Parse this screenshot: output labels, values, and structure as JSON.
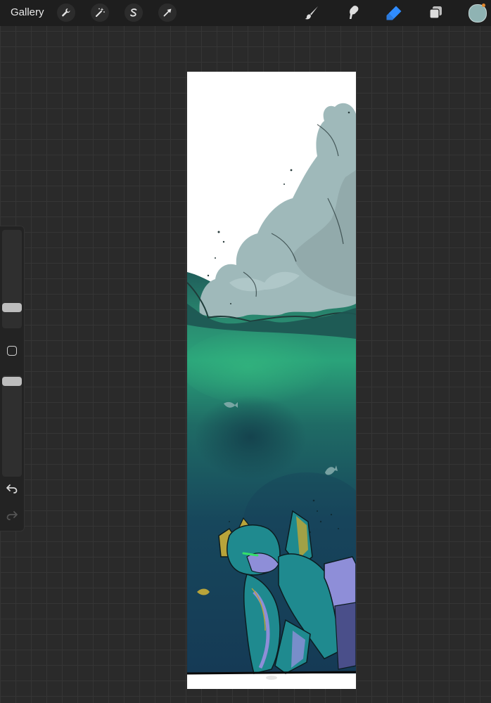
{
  "toolbar": {
    "gallery_label": "Gallery",
    "left_icons": [
      "wrench-icon",
      "magic-wand-icon",
      "selection-s-icon",
      "transform-arrow-icon"
    ],
    "right_icons": [
      "brush-icon",
      "smudge-icon",
      "eraser-icon",
      "layers-icon"
    ],
    "active_tool": "eraser",
    "accent_color": "#2f8cff",
    "current_color": "#8fb3b3",
    "notification_color": "#e0872e"
  },
  "sidebar": {
    "brush_size_level": 0.5,
    "opacity_level": 1.0,
    "icons": [
      "modify-square-icon",
      "undo-icon",
      "redo-icon"
    ]
  },
  "canvas": {
    "background": "#ffffff",
    "palette": {
      "sky": "#ffffff",
      "smoke": "#9fb9ba",
      "smoke_shadow": "#8aa0a2",
      "sea_top": "#1f5d5a",
      "sea_glow": "#2aa37a",
      "sea_deep": "#153a55",
      "robot_teal": "#1f8a8f",
      "robot_lilac": "#8e8ed8",
      "robot_gold": "#b8a43a",
      "robot_eye": "#36e06a"
    }
  }
}
